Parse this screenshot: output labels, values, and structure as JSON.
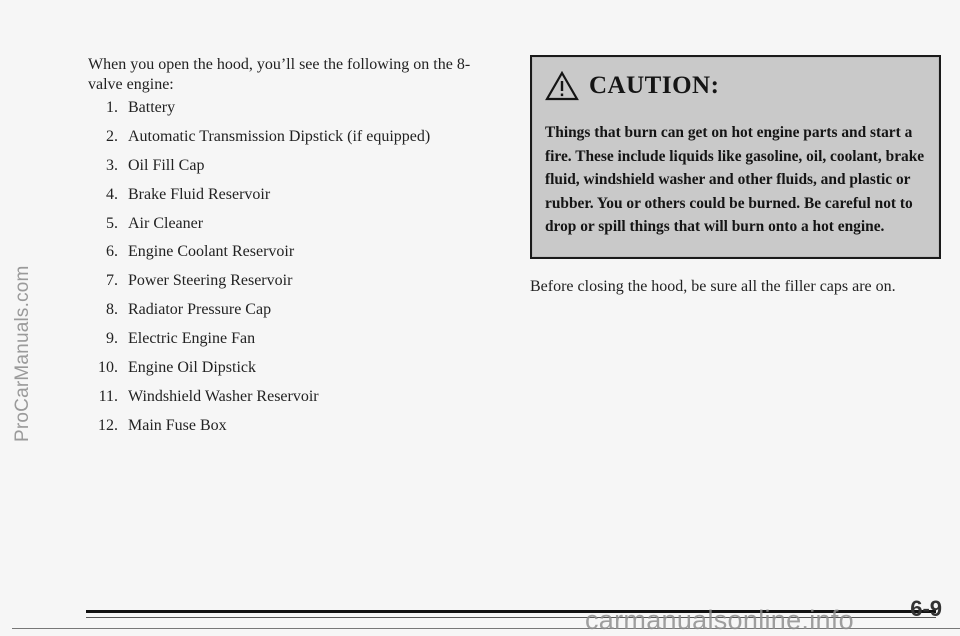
{
  "watermarks": {
    "side": "ProCarManuals.com",
    "bottom": "carmanualsonline.info"
  },
  "intro": "When you open the hood, you’ll see the following on the 8-valve engine:",
  "items": [
    {
      "num": "1.",
      "label": "Battery"
    },
    {
      "num": "2.",
      "label": "Automatic Transmission Dipstick (if equipped)"
    },
    {
      "num": "3.",
      "label": "Oil Fill Cap"
    },
    {
      "num": "4.",
      "label": "Brake Fluid Reservoir"
    },
    {
      "num": "5.",
      "label": "Air Cleaner"
    },
    {
      "num": "6.",
      "label": "Engine Coolant Reservoir"
    },
    {
      "num": "7.",
      "label": "Power Steering Reservoir"
    },
    {
      "num": "8.",
      "label": "Radiator Pressure Cap"
    },
    {
      "num": "9.",
      "label": "Electric Engine Fan"
    },
    {
      "num": "10.",
      "label": "Engine Oil Dipstick"
    },
    {
      "num": "11.",
      "label": "Windshield Washer Reservoir"
    },
    {
      "num": "12.",
      "label": "Main Fuse Box"
    }
  ],
  "caution": {
    "icon": "warning-triangle-icon",
    "title": "CAUTION:",
    "text": "Things that burn can get on hot engine parts and start a fire. These include liquids like gasoline, oil, coolant, brake fluid, windshield washer and other fluids, and plastic or rubber. You or others could be burned. Be careful not to drop or spill things that will burn onto a hot engine."
  },
  "closing_note": "Before closing the hood, be sure all the filler caps are on.",
  "page_number": "6-9"
}
